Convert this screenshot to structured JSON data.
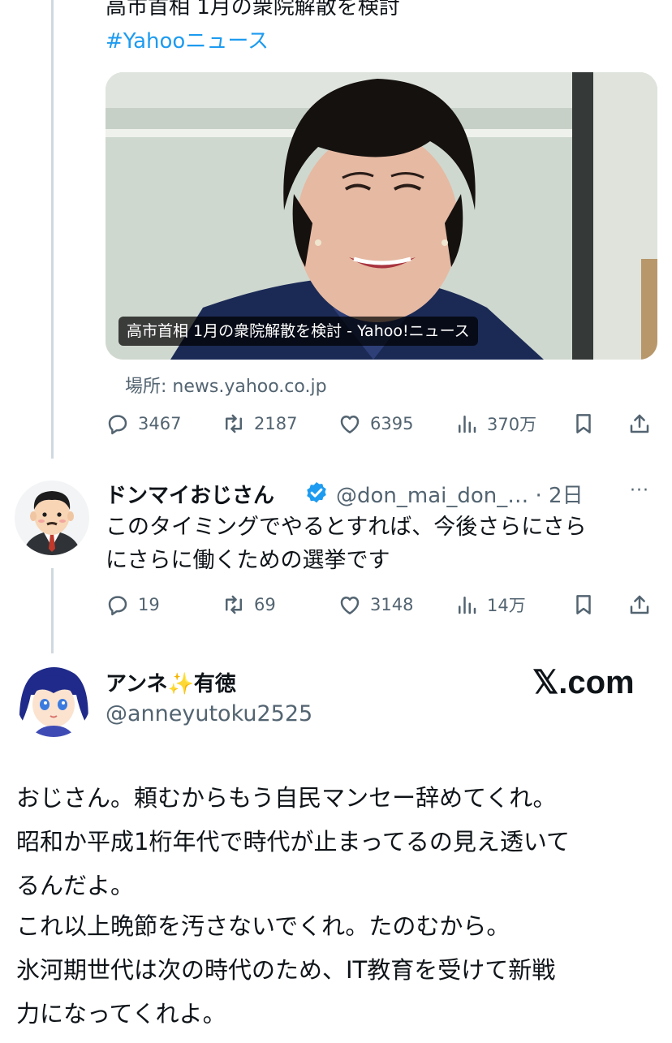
{
  "quoted_post": {
    "title_line": "高市首相 1月の衆院解散を検討",
    "hashtag": "#Yahooニュース",
    "card_caption": "高市首相 1月の衆院解散を検討 - Yahoo!ニュース",
    "source": "場所: news.yahoo.co.jp",
    "stats": {
      "replies": "3467",
      "reposts": "2187",
      "likes": "6395",
      "views": "370万"
    }
  },
  "reply_post": {
    "name": "ドンマイおじさん",
    "handle_time": "@don_mai_don_… · 2日",
    "more": "···",
    "lines": [
      "このタイミングでやるとすれば、今後さらにさら",
      "にさらに働くための選挙です"
    ],
    "stats": {
      "replies": "19",
      "reposts": "69",
      "likes": "3148",
      "views": "14万"
    }
  },
  "main_post": {
    "name_part1": "アンネ",
    "name_sparkle": "✨",
    "name_part2": "有徳",
    "handle": "@anneyutoku2525",
    "watermark": "𝕏.com",
    "lines": [
      "おじさん。頼むからもう自民マンセー辞めてくれ。",
      "昭和か平成1桁年代で時代が止まってるの見え透いて",
      "るんだよ。",
      "これ以上晩節を汚さないでくれ。たのむから。",
      "氷河期世代は次の時代のため、IT教育を受けて新戦",
      "力になってくれよ。"
    ]
  },
  "colors": {
    "accent": "#1d9bf0",
    "secondary_text": "#536471",
    "text": "#0f1419",
    "thread_line": "#cfd9de"
  }
}
